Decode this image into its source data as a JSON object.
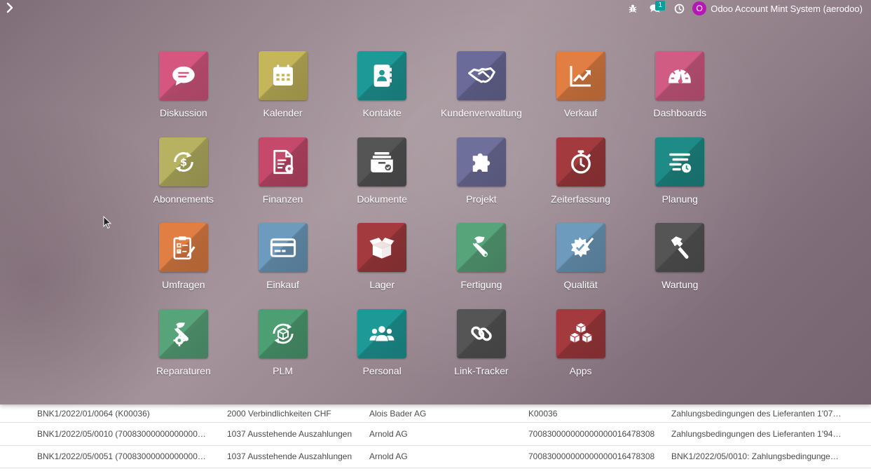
{
  "systray": {
    "chat_count": "1",
    "user_initial": "O",
    "user_name": "Odoo Account Mint System (aerodoo)"
  },
  "apps": [
    {
      "label": "Diskussion",
      "color": "#d5577f",
      "icon": "chat-bubble-icon"
    },
    {
      "label": "Kalender",
      "color": "#c5b65c",
      "icon": "calendar-icon"
    },
    {
      "label": "Kontakte",
      "color": "#1d9a98",
      "icon": "contact-book-icon"
    },
    {
      "label": "Kundenverwaltung",
      "color": "#6b6b9a",
      "icon": "handshake-icon"
    },
    {
      "label": "Verkauf",
      "color": "#e07e44",
      "icon": "trending-chart-icon"
    },
    {
      "label": "Dashboards",
      "color": "#d05b83",
      "icon": "speedometer-icon"
    },
    {
      "label": "Abonnements",
      "color": "#b7b261",
      "icon": "recurring-dollar-icon"
    },
    {
      "label": "Finanzen",
      "color": "#c4496b",
      "icon": "invoice-gear-icon"
    },
    {
      "label": "Dokumente",
      "color": "#555555",
      "icon": "document-tray-icon"
    },
    {
      "label": "Projekt",
      "color": "#6f6f9b",
      "icon": "puzzle-icon"
    },
    {
      "label": "Zeiterfassung",
      "color": "#a33a3e",
      "icon": "stopwatch-icon"
    },
    {
      "label": "Planung",
      "color": "#1e8b86",
      "icon": "planning-clock-icon"
    },
    {
      "label": "Umfragen",
      "color": "#e07e44",
      "icon": "survey-clipboard-icon"
    },
    {
      "label": "Einkauf",
      "color": "#6d9bbd",
      "icon": "credit-card-icon"
    },
    {
      "label": "Lager",
      "color": "#a33a3e",
      "icon": "open-box-icon"
    },
    {
      "label": "Fertigung",
      "color": "#58a47a",
      "icon": "wrench-icon"
    },
    {
      "label": "Qualität",
      "color": "#6d9bbd",
      "icon": "quality-seal-icon"
    },
    {
      "label": "Wartung",
      "color": "#555555",
      "icon": "hammer-icon"
    },
    {
      "label": "Reparaturen",
      "color": "#58a47a",
      "icon": "repair-wrench-gear-icon"
    },
    {
      "label": "PLM",
      "color": "#4e9e73",
      "icon": "cycle-cube-icon"
    },
    {
      "label": "Personal",
      "color": "#1d9a98",
      "icon": "people-group-icon"
    },
    {
      "label": "Link-Tracker",
      "color": "#555555",
      "icon": "link-chain-icon"
    },
    {
      "label": "Apps",
      "color": "#a33a3e",
      "icon": "cubes-icon"
    }
  ],
  "list_rows": [
    [
      "BNK1/2022/01/0064 (K00036)",
      "2000 Verbindlichkeiten CHF",
      "Alois Bader AG",
      "K00036",
      "Zahlungsbedingungen des Lieferanten 1'07…"
    ],
    [
      "BNK1/2022/05/0010 (70083000000000000…",
      "1037 Ausstehende Auszahlungen",
      "Arnold AG",
      "700830000000000000016478308",
      "Zahlungsbedingungen des Lieferanten 1'94…"
    ],
    [
      "BNK1/2022/05/0051 (70083000000000000…",
      "1037 Ausstehende Auszahlungen",
      "Arnold AG",
      "700830000000000000016478308",
      "BNK1/2022/05/0010: Zahlungsbedingunge…"
    ]
  ]
}
